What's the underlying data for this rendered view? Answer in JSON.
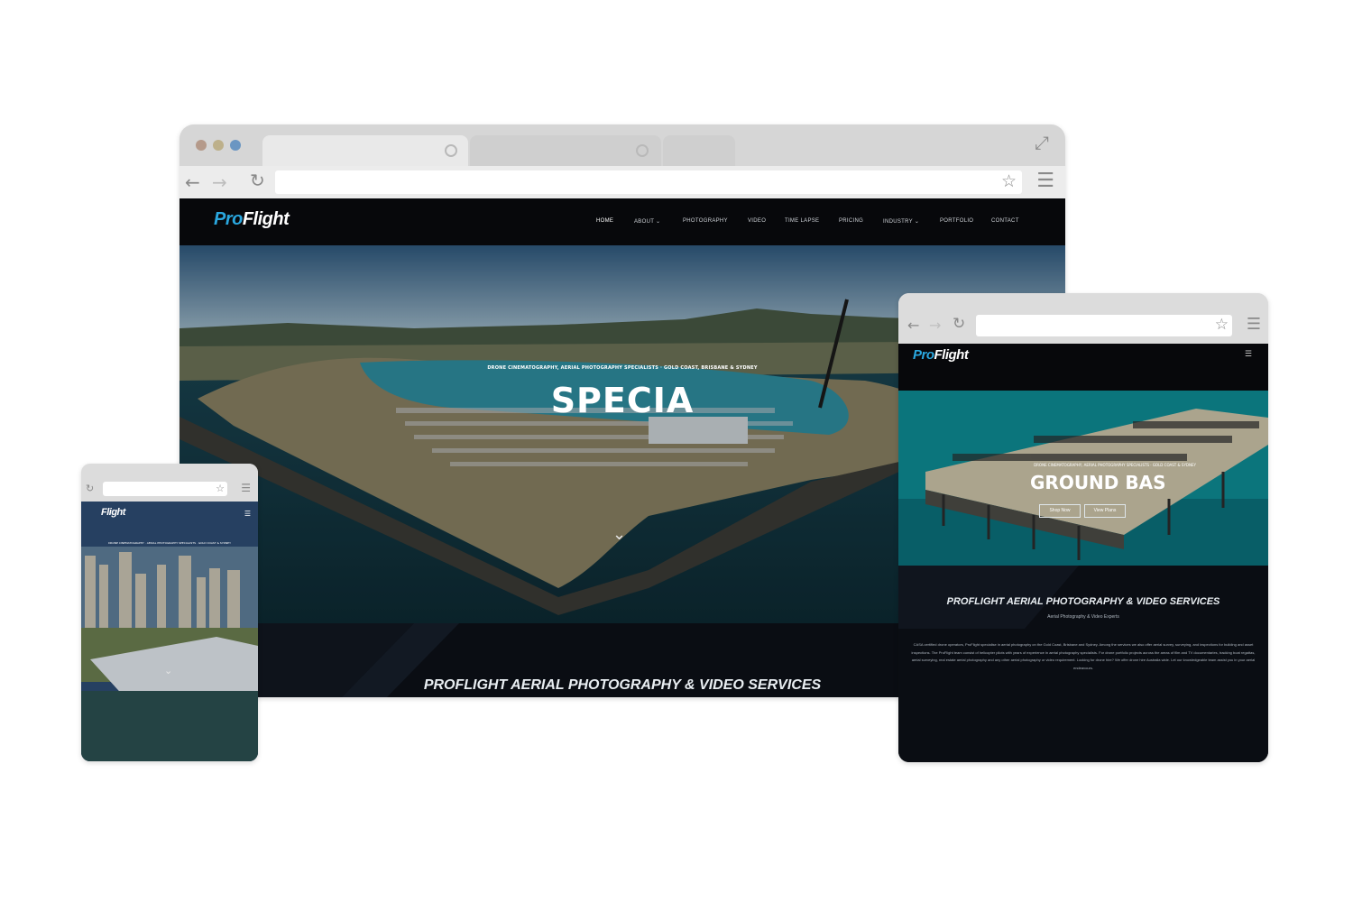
{
  "brand": {
    "logo_pro": "Pro",
    "logo_flight": "Flight"
  },
  "desktop": {
    "nav": [
      "Home",
      "About ⌄",
      "Photography",
      "Video",
      "Time Lapse",
      "Pricing",
      "Industry ⌄",
      "Portfolio",
      "Contact"
    ],
    "hero_tagline": "DRONE CINEMATOGRAPHY, AERIAL PHOTOGRAPHY SPECIALISTS · GOLD COAST, BRISBANE & SYDNEY",
    "hero_heading": "SPECIA",
    "section_title": "PROFLIGHT AERIAL PHOTOGRAPHY & VIDEO SERVICES",
    "scroll_icon": "chevron-down-icon"
  },
  "tablet": {
    "hero_tagline": "DRONE CINEMATOGRAPHY, AERIAL PHOTOGRAPHY SPECIALISTS · GOLD COAST & SYDNEY",
    "hero_heading": "GROUND BAS",
    "buttons": [
      "Shop Now",
      "View Plans"
    ],
    "section_title": "PROFLIGHT AERIAL PHOTOGRAPHY & VIDEO SERVICES",
    "section_subtitle": "Aerial Photography & Video Experts",
    "body": "CASA certified drone operators, ProFlight specialise in aerial photography on the Gold Coast, Brisbane and Sydney. Among the services we also offer aerial survey, surveying, and inspections for building and asset inspections. The ProFlight team consist of helicopter pilots with years of experience in aerial photography specialists. For drone portfolio projects across the areas of film and TV documentaries, tracking boat regattas, aerial surveying, real estate aerial photography and any other aerial photography or video requirement. Looking for drone hire? We offer drone hire Australia wide. Let our knowledgeable team assist you in your aerial endeavours."
  },
  "mobile": {
    "hero_tagline": "DRONE CINEMATOGRAPHY · AERIAL PHOTOGRAPHY SPECIALISTS · GOLD COAST & SYDNEY"
  },
  "colors": {
    "accent": "#2aa7df",
    "nav_bg": "#07080b",
    "page_bg": "#0a0d13",
    "chrome": "#e9e9e9"
  }
}
